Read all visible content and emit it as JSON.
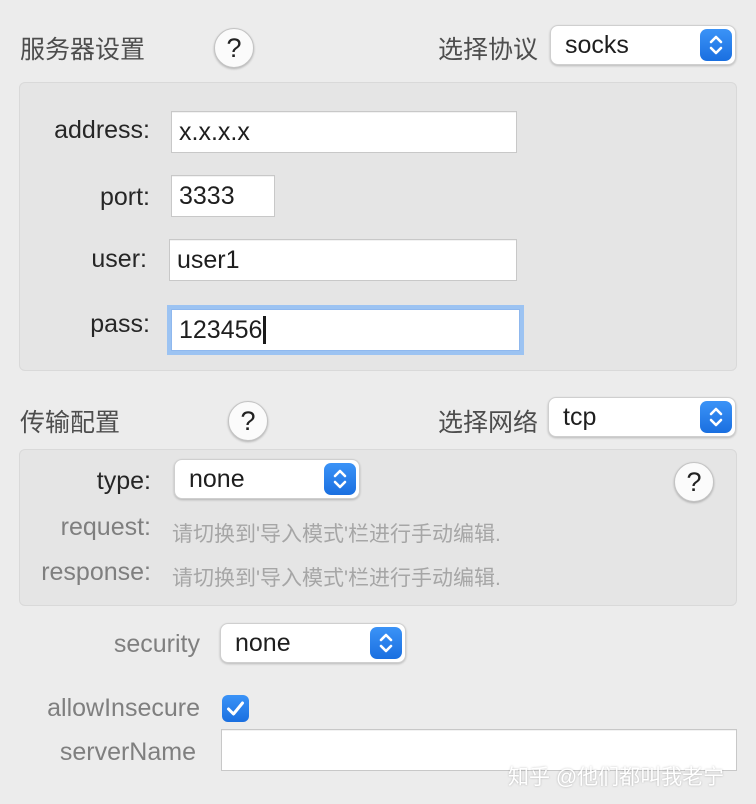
{
  "server": {
    "title": "服务器设置",
    "help": "?",
    "protocol_label": "选择协议",
    "protocol_value": "socks",
    "address_label": "address:",
    "address_value": "x.x.x.x",
    "port_label": "port:",
    "port_value": "3333",
    "user_label": "user:",
    "user_value": "user1",
    "pass_label": "pass:",
    "pass_value": "123456"
  },
  "transport": {
    "title": "传输配置",
    "help": "?",
    "network_label": "选择网络",
    "network_value": "tcp",
    "type_label": "type:",
    "type_value": "none",
    "type_help": "?",
    "request_label": "request:",
    "request_hint": "请切换到'导入模式'栏进行手动编辑.",
    "response_label": "response:",
    "response_hint": "请切换到'导入模式'栏进行手动编辑."
  },
  "security": {
    "label": "security",
    "value": "none",
    "allow_insecure_label": "allowInsecure",
    "allow_insecure_checked": true,
    "server_name_label": "serverName",
    "server_name_value": ""
  },
  "watermark": "知乎 @他们都叫我老宁",
  "colors": {
    "accent": "#1a7cf0",
    "focus_ring": "#9cc3f2",
    "window_bg": "#ececec",
    "panel_bg": "#e5e5e5"
  }
}
